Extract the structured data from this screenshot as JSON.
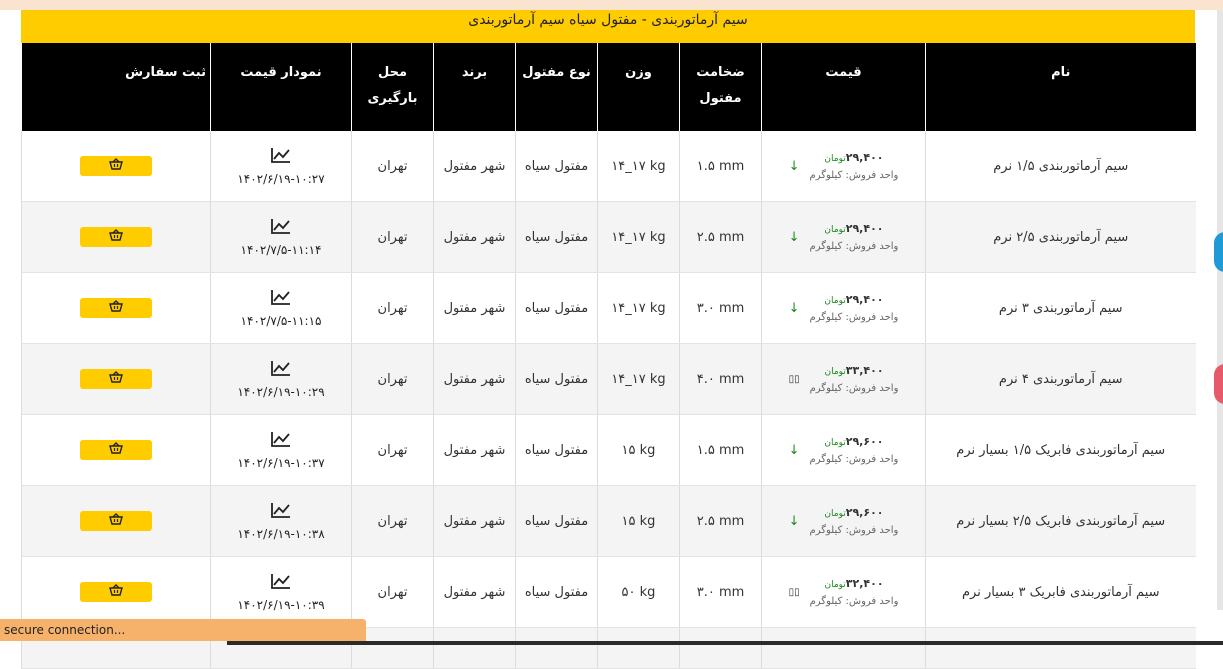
{
  "header_title": "سیم آرماتوربندی - مفتول سیاه  سیم آرماتوربندی",
  "columns": {
    "name": "نام",
    "price": "قیمت",
    "thickness": "ضخامت مفتول",
    "weight": "وزن",
    "type": "نوع مفتول",
    "brand": "برند",
    "location": "محل بارگیری",
    "chart": "نمودار قیمت",
    "order": "ثبت سفارش"
  },
  "rows": [
    {
      "name": "سیم آرماتوربندی ۱/۵ نرم",
      "price": "۲۹,۴۰۰",
      "price_unit": "تومان",
      "sale_unit": "واحد فروش: کیلوگرم",
      "trend": "↓",
      "thickness": "۱.۵ mm",
      "weight": "۱۴_۱۷ kg",
      "type": "مفتول سیاه",
      "brand": "شهر مفتول",
      "location": "تهران",
      "date": "۱۴۰۲/۶/۱۹-۱۰:۲۷"
    },
    {
      "name": "سیم آرماتوربندی ۲/۵ نرم",
      "price": "۲۹,۴۰۰",
      "price_unit": "تومان",
      "sale_unit": "واحد فروش: کیلوگرم",
      "trend": "↓",
      "thickness": "۲.۵ mm",
      "weight": "۱۴_۱۷ kg",
      "type": "مفتول سیاه",
      "brand": "شهر مفتول",
      "location": "تهران",
      "date": "۱۴۰۲/۷/۵-۱۱:۱۴"
    },
    {
      "name": "سیم آرماتوربندی ۳ نرم",
      "price": "۲۹,۴۰۰",
      "price_unit": "تومان",
      "sale_unit": "واحد فروش: کیلوگرم",
      "trend": "↓",
      "thickness": "۳.۰ mm",
      "weight": "۱۴_۱۷ kg",
      "type": "مفتول سیاه",
      "brand": "شهر مفتول",
      "location": "تهران",
      "date": "۱۴۰۲/۷/۵-۱۱:۱۵"
    },
    {
      "name": "سیم آرماتوربندی ۴ نرم",
      "price": "۳۳,۴۰۰",
      "price_unit": "تومان",
      "sale_unit": "واحد فروش: کیلوگرم",
      "trend": "▯▯",
      "thickness": "۴.۰ mm",
      "weight": "۱۴_۱۷ kg",
      "type": "مفتول سیاه",
      "brand": "شهر مفتول",
      "location": "تهران",
      "date": "۱۴۰۲/۶/۱۹-۱۰:۲۹"
    },
    {
      "name": "سیم آرماتوربندی فابریک ۱/۵ بسیار نرم",
      "price": "۲۹,۶۰۰",
      "price_unit": "تومان",
      "sale_unit": "واحد فروش: کیلوگرم",
      "trend": "↓",
      "thickness": "۱.۵ mm",
      "weight": "۱۵ kg",
      "type": "مفتول سیاه",
      "brand": "شهر مفتول",
      "location": "تهران",
      "date": "۱۴۰۲/۶/۱۹-۱۰:۳۷"
    },
    {
      "name": "سیم آرماتوربندی فابریک ۲/۵ بسیار نرم",
      "price": "۲۹,۶۰۰",
      "price_unit": "تومان",
      "sale_unit": "واحد فروش: کیلوگرم",
      "trend": "↓",
      "thickness": "۲.۵ mm",
      "weight": "۱۵ kg",
      "type": "مفتول سیاه",
      "brand": "شهر مفتول",
      "location": "تهران",
      "date": "۱۴۰۲/۶/۱۹-۱۰:۳۸"
    },
    {
      "name": "سیم آرماتوربندی فابریک ۳ بسیار نرم",
      "price": "۳۲,۴۰۰",
      "price_unit": "تومان",
      "sale_unit": "واحد فروش: کیلوگرم",
      "trend": "▯▯",
      "thickness": "۳.۰ mm",
      "weight": "۵۰ kg",
      "type": "مفتول سیاه",
      "brand": "شهر مفتول",
      "location": "تهران",
      "date": "۱۴۰۲/۶/۱۹-۱۰:۳۹"
    }
  ],
  "status_bar": "secure connection...",
  "colors": {
    "accent": "#ffcc00",
    "header_bg": "#000000",
    "trend_down": "#1a8a1a",
    "status_bar": "#f6b26b"
  },
  "icons": {
    "chart": "line-chart-icon",
    "order": "basket-icon"
  }
}
